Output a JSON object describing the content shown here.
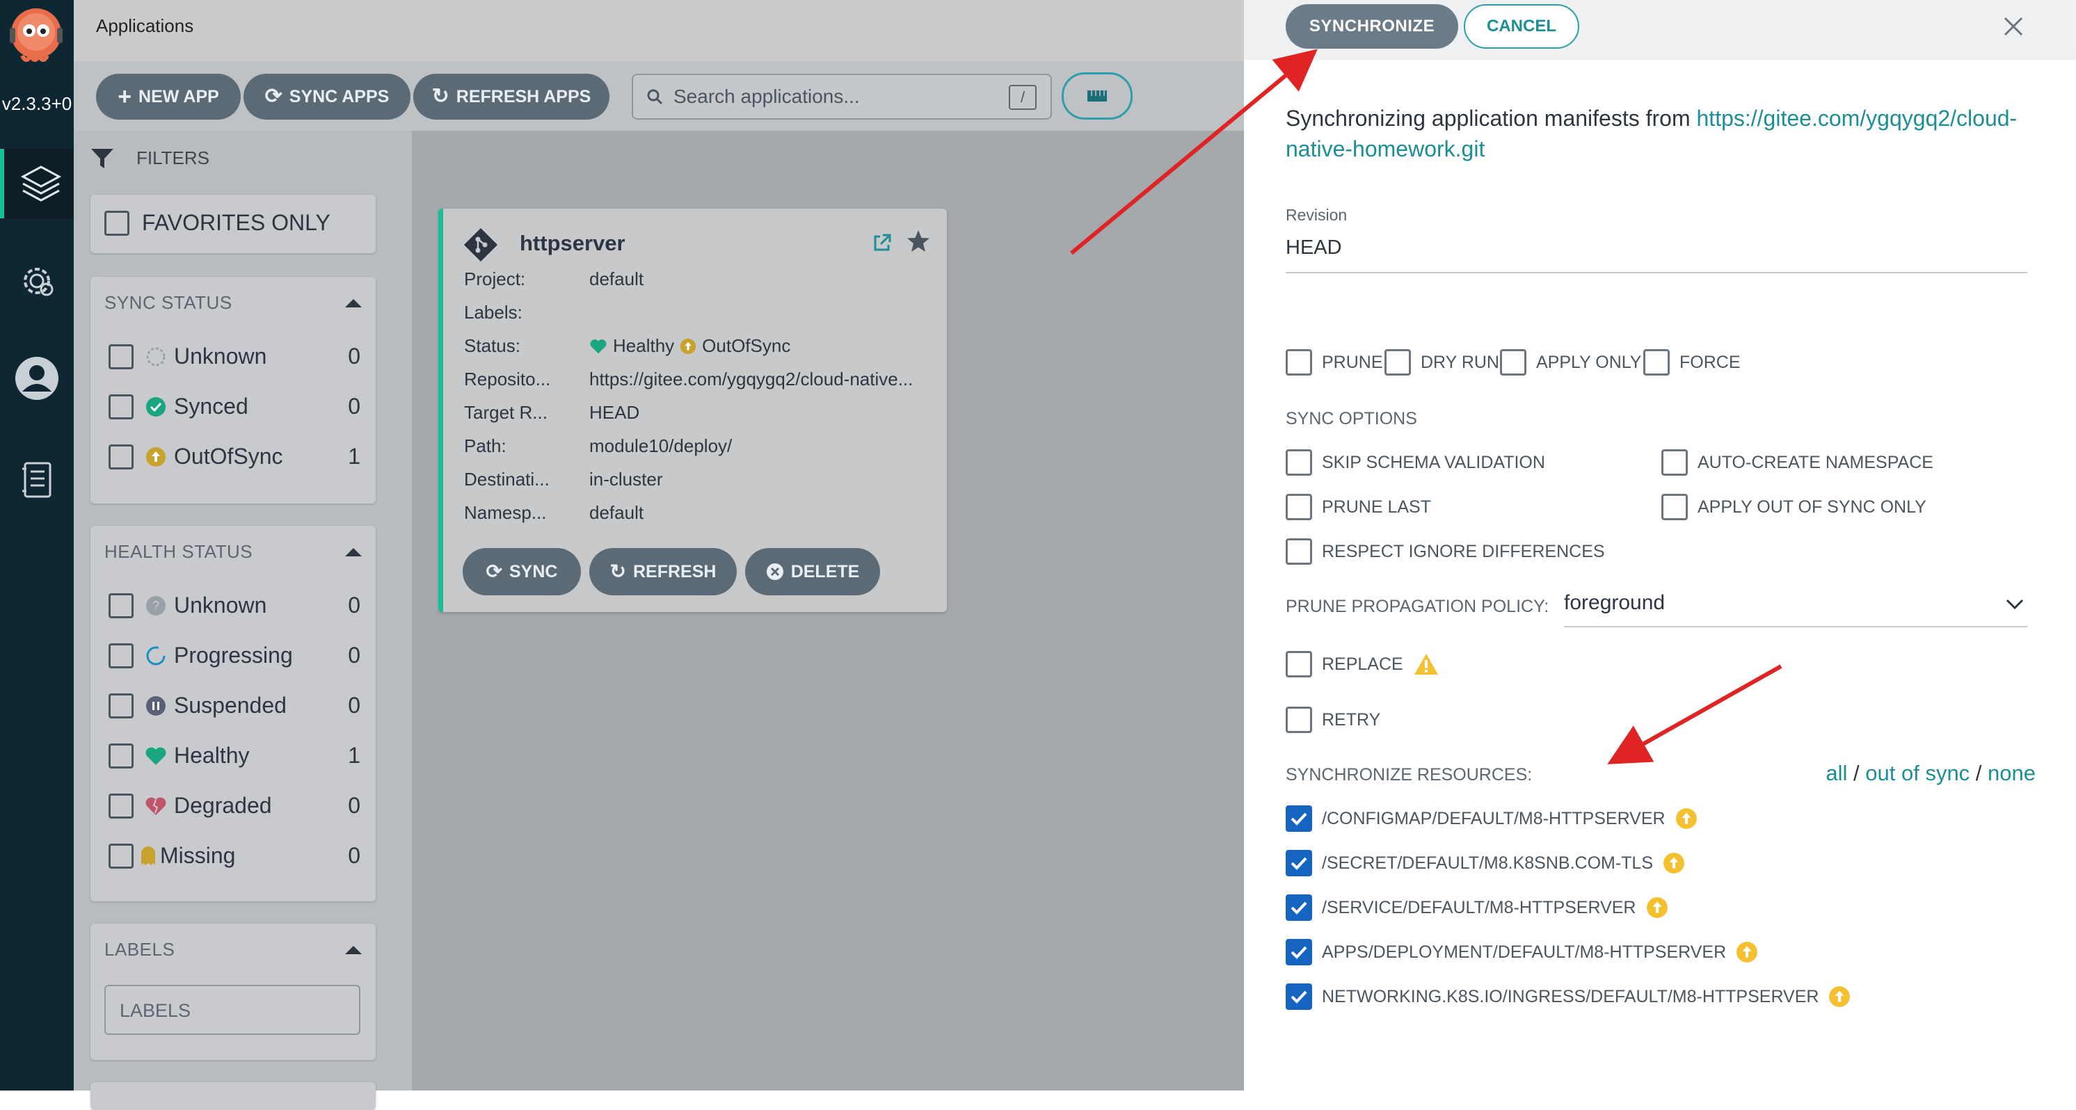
{
  "rail": {
    "version": "v2.3.3+0",
    "nav": [
      "applications-icon",
      "settings-icon",
      "user-icon",
      "docs-icon"
    ]
  },
  "header": {
    "title": "Applications"
  },
  "toolbar": {
    "new_app": "NEW APP",
    "sync_apps": "SYNC APPS",
    "refresh_apps": "REFRESH APPS",
    "search_placeholder": "Search applications...",
    "search_shortcut": "/"
  },
  "filters": {
    "title": "FILTERS",
    "favorites_only": "FAVORITES ONLY",
    "sync_status": {
      "title": "SYNC STATUS",
      "items": [
        {
          "label": "Unknown",
          "count": "0"
        },
        {
          "label": "Synced",
          "count": "0"
        },
        {
          "label": "OutOfSync",
          "count": "1"
        }
      ]
    },
    "health_status": {
      "title": "HEALTH STATUS",
      "items": [
        {
          "label": "Unknown",
          "count": "0"
        },
        {
          "label": "Progressing",
          "count": "0"
        },
        {
          "label": "Suspended",
          "count": "0"
        },
        {
          "label": "Healthy",
          "count": "1"
        },
        {
          "label": "Degraded",
          "count": "0"
        },
        {
          "label": "Missing",
          "count": "0"
        }
      ]
    },
    "labels": {
      "title": "LABELS",
      "placeholder": "LABELS"
    }
  },
  "app_card": {
    "name": "httpserver",
    "rows": [
      {
        "key": "Project:",
        "value": "default"
      },
      {
        "key": "Labels:",
        "value": ""
      },
      {
        "key": "Status:",
        "health": "Healthy",
        "sync": "OutOfSync"
      },
      {
        "key": "Reposito...",
        "value": "https://gitee.com/ygqygq2/cloud-native..."
      },
      {
        "key": "Target R...",
        "value": "HEAD"
      },
      {
        "key": "Path:",
        "value": "module10/deploy/"
      },
      {
        "key": "Destinati...",
        "value": "in-cluster"
      },
      {
        "key": "Namesp...",
        "value": "default"
      }
    ],
    "buttons": {
      "sync": "SYNC",
      "refresh": "REFRESH",
      "delete": "DELETE"
    }
  },
  "drawer": {
    "synchronize": "SYNCHRONIZE",
    "cancel": "CANCEL",
    "intro": "Synchronizing application manifests from ",
    "repo_url": "https://gitee.com/ygqygq2/cloud-native-homework.git",
    "revision_label": "Revision",
    "revision_value": "HEAD",
    "flags": [
      "PRUNE",
      "DRY RUN",
      "APPLY ONLY",
      "FORCE"
    ],
    "sync_options_title": "SYNC OPTIONS",
    "sync_options": {
      "skip_schema": "SKIP SCHEMA VALIDATION",
      "auto_ns": "AUTO-CREATE NAMESPACE",
      "prune_last": "PRUNE LAST",
      "apply_oos": "APPLY OUT OF SYNC ONLY",
      "respect_ignore": "RESPECT IGNORE DIFFERENCES"
    },
    "policy_label": "PRUNE PROPAGATION POLICY:",
    "policy_value": "foreground",
    "replace": "REPLACE",
    "retry": "RETRY",
    "resources_title": "SYNCHRONIZE RESOURCES:",
    "select": {
      "all": "all",
      "sep1": " / ",
      "out_of_sync": "out of sync",
      "sep2": " / ",
      "none": "none"
    },
    "resources": [
      "/CONFIGMAP/DEFAULT/M8-HTTPSERVER",
      "/SECRET/DEFAULT/M8.K8SNB.COM-TLS",
      "/SERVICE/DEFAULT/M8-HTTPSERVER",
      "APPS/DEPLOYMENT/DEFAULT/M8-HTTPSERVER",
      "NETWORKING.K8S.IO/INGRESS/DEFAULT/M8-HTTPSERVER"
    ]
  },
  "colors": {
    "accent": "#18be94",
    "link": "#1b8e96",
    "checkbox": "#1565c0",
    "warning": "#f4c030",
    "arrow": "#e02424"
  }
}
